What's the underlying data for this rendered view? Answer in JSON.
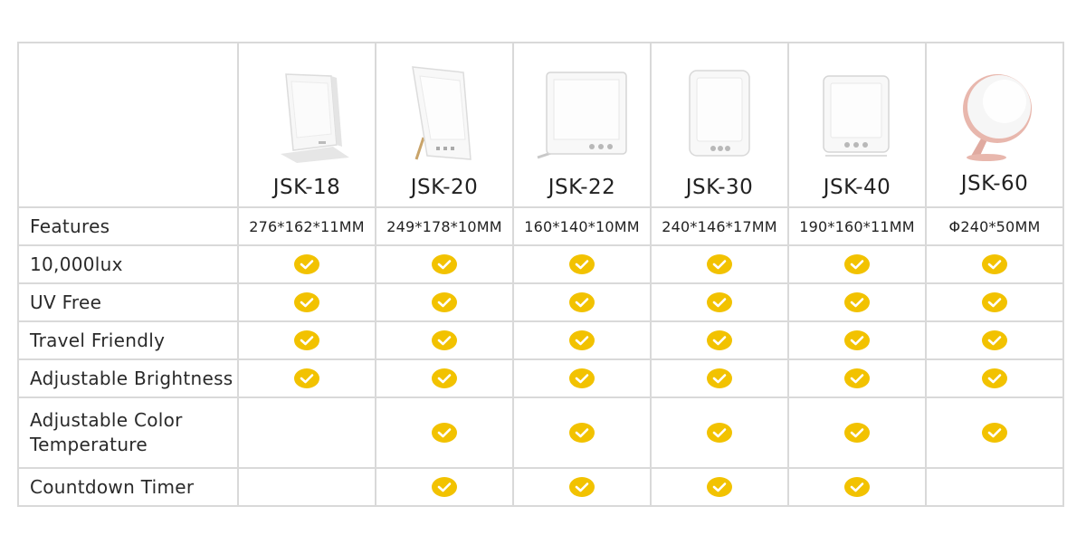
{
  "products": [
    {
      "name": "JSK-18",
      "dimension": "276*162*11MM"
    },
    {
      "name": "JSK-20",
      "dimension": "249*178*10MM"
    },
    {
      "name": "JSK-22",
      "dimension": "160*140*10MM"
    },
    {
      "name": "JSK-30",
      "dimension": "240*146*17MM"
    },
    {
      "name": "JSK-40",
      "dimension": "190*160*11MM"
    },
    {
      "name": "JSK-60",
      "dimension": "Φ240*50MM"
    }
  ],
  "features_label": "Features",
  "rows": [
    {
      "label": "10,000lux",
      "checks": [
        true,
        true,
        true,
        true,
        true,
        true
      ]
    },
    {
      "label": "UV Free",
      "checks": [
        true,
        true,
        true,
        true,
        true,
        true
      ]
    },
    {
      "label": "Travel Friendly",
      "checks": [
        true,
        true,
        true,
        true,
        true,
        true
      ]
    },
    {
      "label": "Adjustable Brightness",
      "checks": [
        true,
        true,
        true,
        true,
        true,
        true
      ]
    },
    {
      "label_lines": [
        "Adjustable Color",
        "Temperature"
      ],
      "checks": [
        false,
        true,
        true,
        true,
        true,
        true
      ]
    },
    {
      "label": "Countdown Timer",
      "checks": [
        false,
        true,
        true,
        true,
        true,
        false
      ]
    }
  ],
  "colors": {
    "check": "#f2c200",
    "border": "#d9d9d9",
    "rose_gold": "#e8b7ad"
  }
}
